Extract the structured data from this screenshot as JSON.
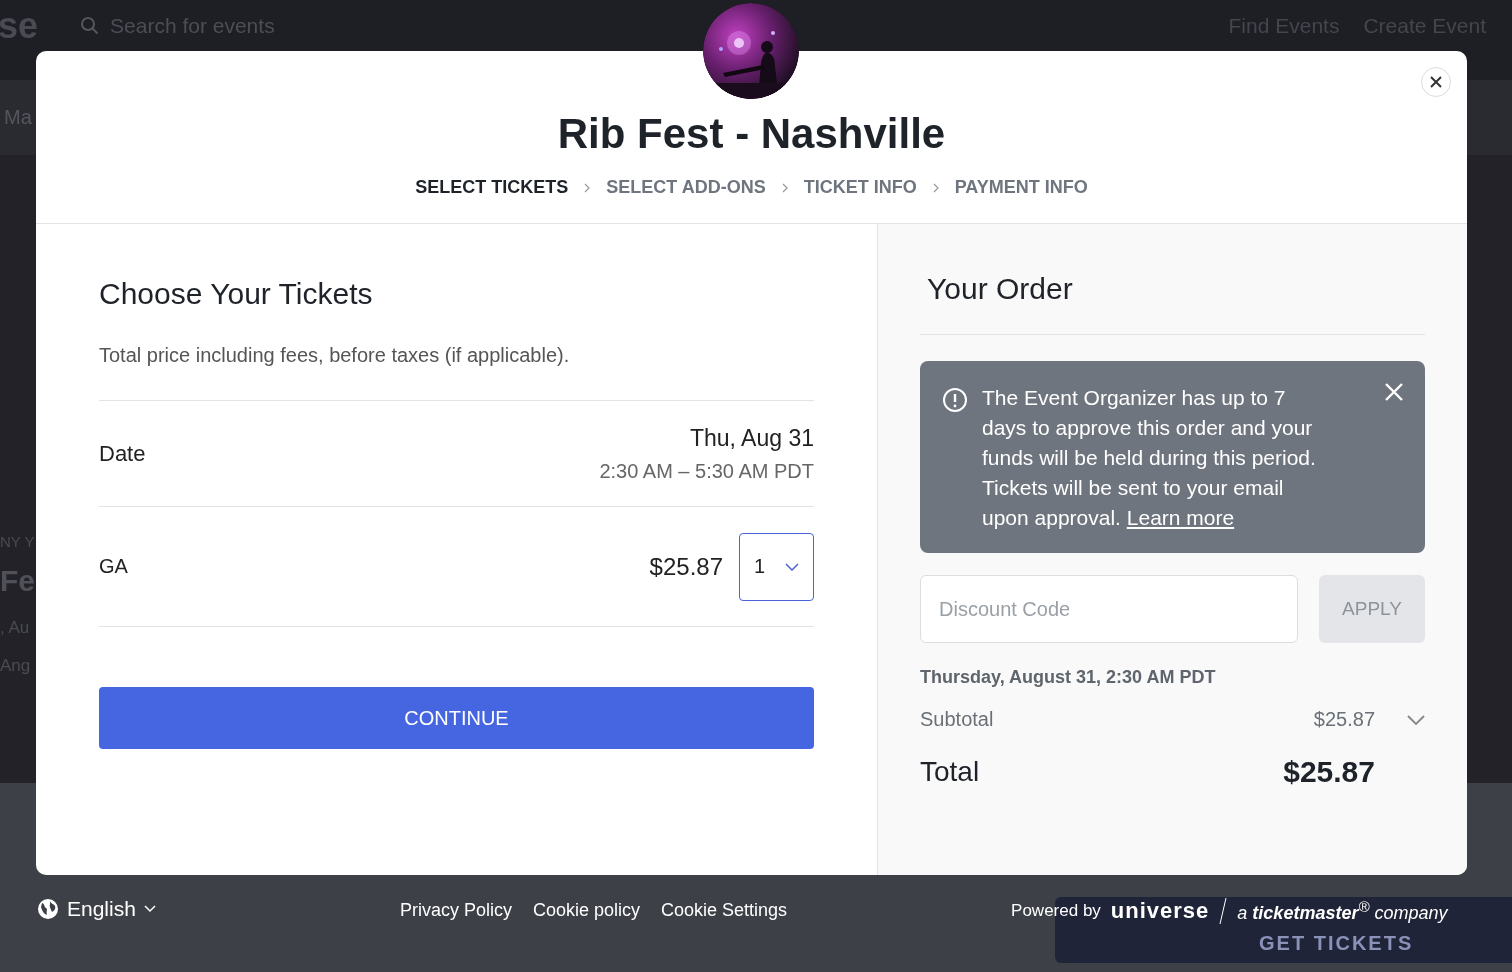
{
  "background": {
    "logo_fragment": "se",
    "search_placeholder": "Search for events",
    "nav": [
      "Find Events",
      "Create Event"
    ],
    "subnav_fragment": "Ma",
    "side_fragments": [
      "NY Y",
      "Fe",
      ", Au",
      "Ang"
    ],
    "get_tickets": "GET TICKETS"
  },
  "modal": {
    "title": "Rib Fest - Nashville",
    "steps": [
      {
        "label": "SELECT TICKETS",
        "selected": true
      },
      {
        "label": "SELECT ADD-ONS",
        "selected": false
      },
      {
        "label": "TICKET INFO",
        "selected": false
      },
      {
        "label": "PAYMENT INFO",
        "selected": false
      }
    ],
    "tickets": {
      "heading": "Choose Your Tickets",
      "note": "Total price including fees, before taxes (if applicable).",
      "date_label": "Date",
      "date": "Thu, Aug 31",
      "time": "2:30 AM – 5:30 AM PDT",
      "ticket_name": "GA",
      "price": "$25.87",
      "quantity": "1",
      "continue": "CONTINUE"
    },
    "order": {
      "heading": "Your Order",
      "notice": "The Event Organizer has up to 7 days to approve this order and your funds will be held during this period. Tickets will be sent to your email upon approval.",
      "notice_link": "Learn more",
      "discount_placeholder": "Discount Code",
      "apply": "APPLY",
      "apply_disabled": true,
      "event_datetime": "Thursday, August 31, 2:30 AM PDT",
      "subtotal_label": "Subtotal",
      "subtotal": "$25.87",
      "total_label": "Total",
      "total": "$25.87"
    }
  },
  "footer": {
    "language": "English",
    "links": [
      "Privacy Policy",
      "Cookie policy",
      "Cookie Settings"
    ],
    "powered_by": "Powered by",
    "brand": "universe",
    "company": "a **ticketmaster**$^{®}$ company"
  }
}
